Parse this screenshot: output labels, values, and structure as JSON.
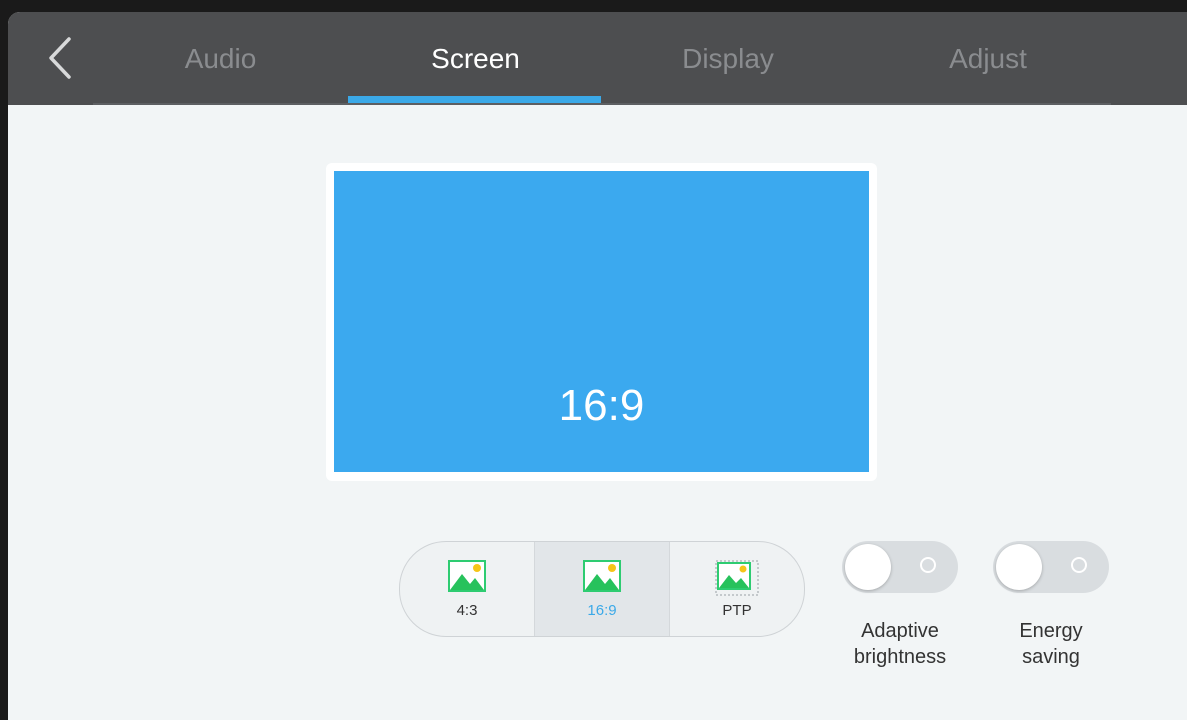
{
  "nav": {
    "back_icon": "chevron-left-icon",
    "tabs": [
      {
        "label": "Audio",
        "active": false
      },
      {
        "label": "Screen",
        "active": true
      },
      {
        "label": "Display",
        "active": false
      },
      {
        "label": "Adjust",
        "active": false
      }
    ],
    "accent_color": "#3ba9e8"
  },
  "preview": {
    "label": "16:9",
    "color": "#3ba9ef"
  },
  "aspect_ratio": {
    "selected": "16:9",
    "options": [
      {
        "label": "4:3",
        "icon": "image-icon"
      },
      {
        "label": "16:9",
        "icon": "image-icon"
      },
      {
        "label": "PTP",
        "icon": "image-dashed-icon"
      }
    ]
  },
  "toggles": [
    {
      "label_line1": "Adaptive",
      "label_line2": "brightness",
      "on": false
    },
    {
      "label_line1": "Energy",
      "label_line2": "saving",
      "on": false
    }
  ]
}
